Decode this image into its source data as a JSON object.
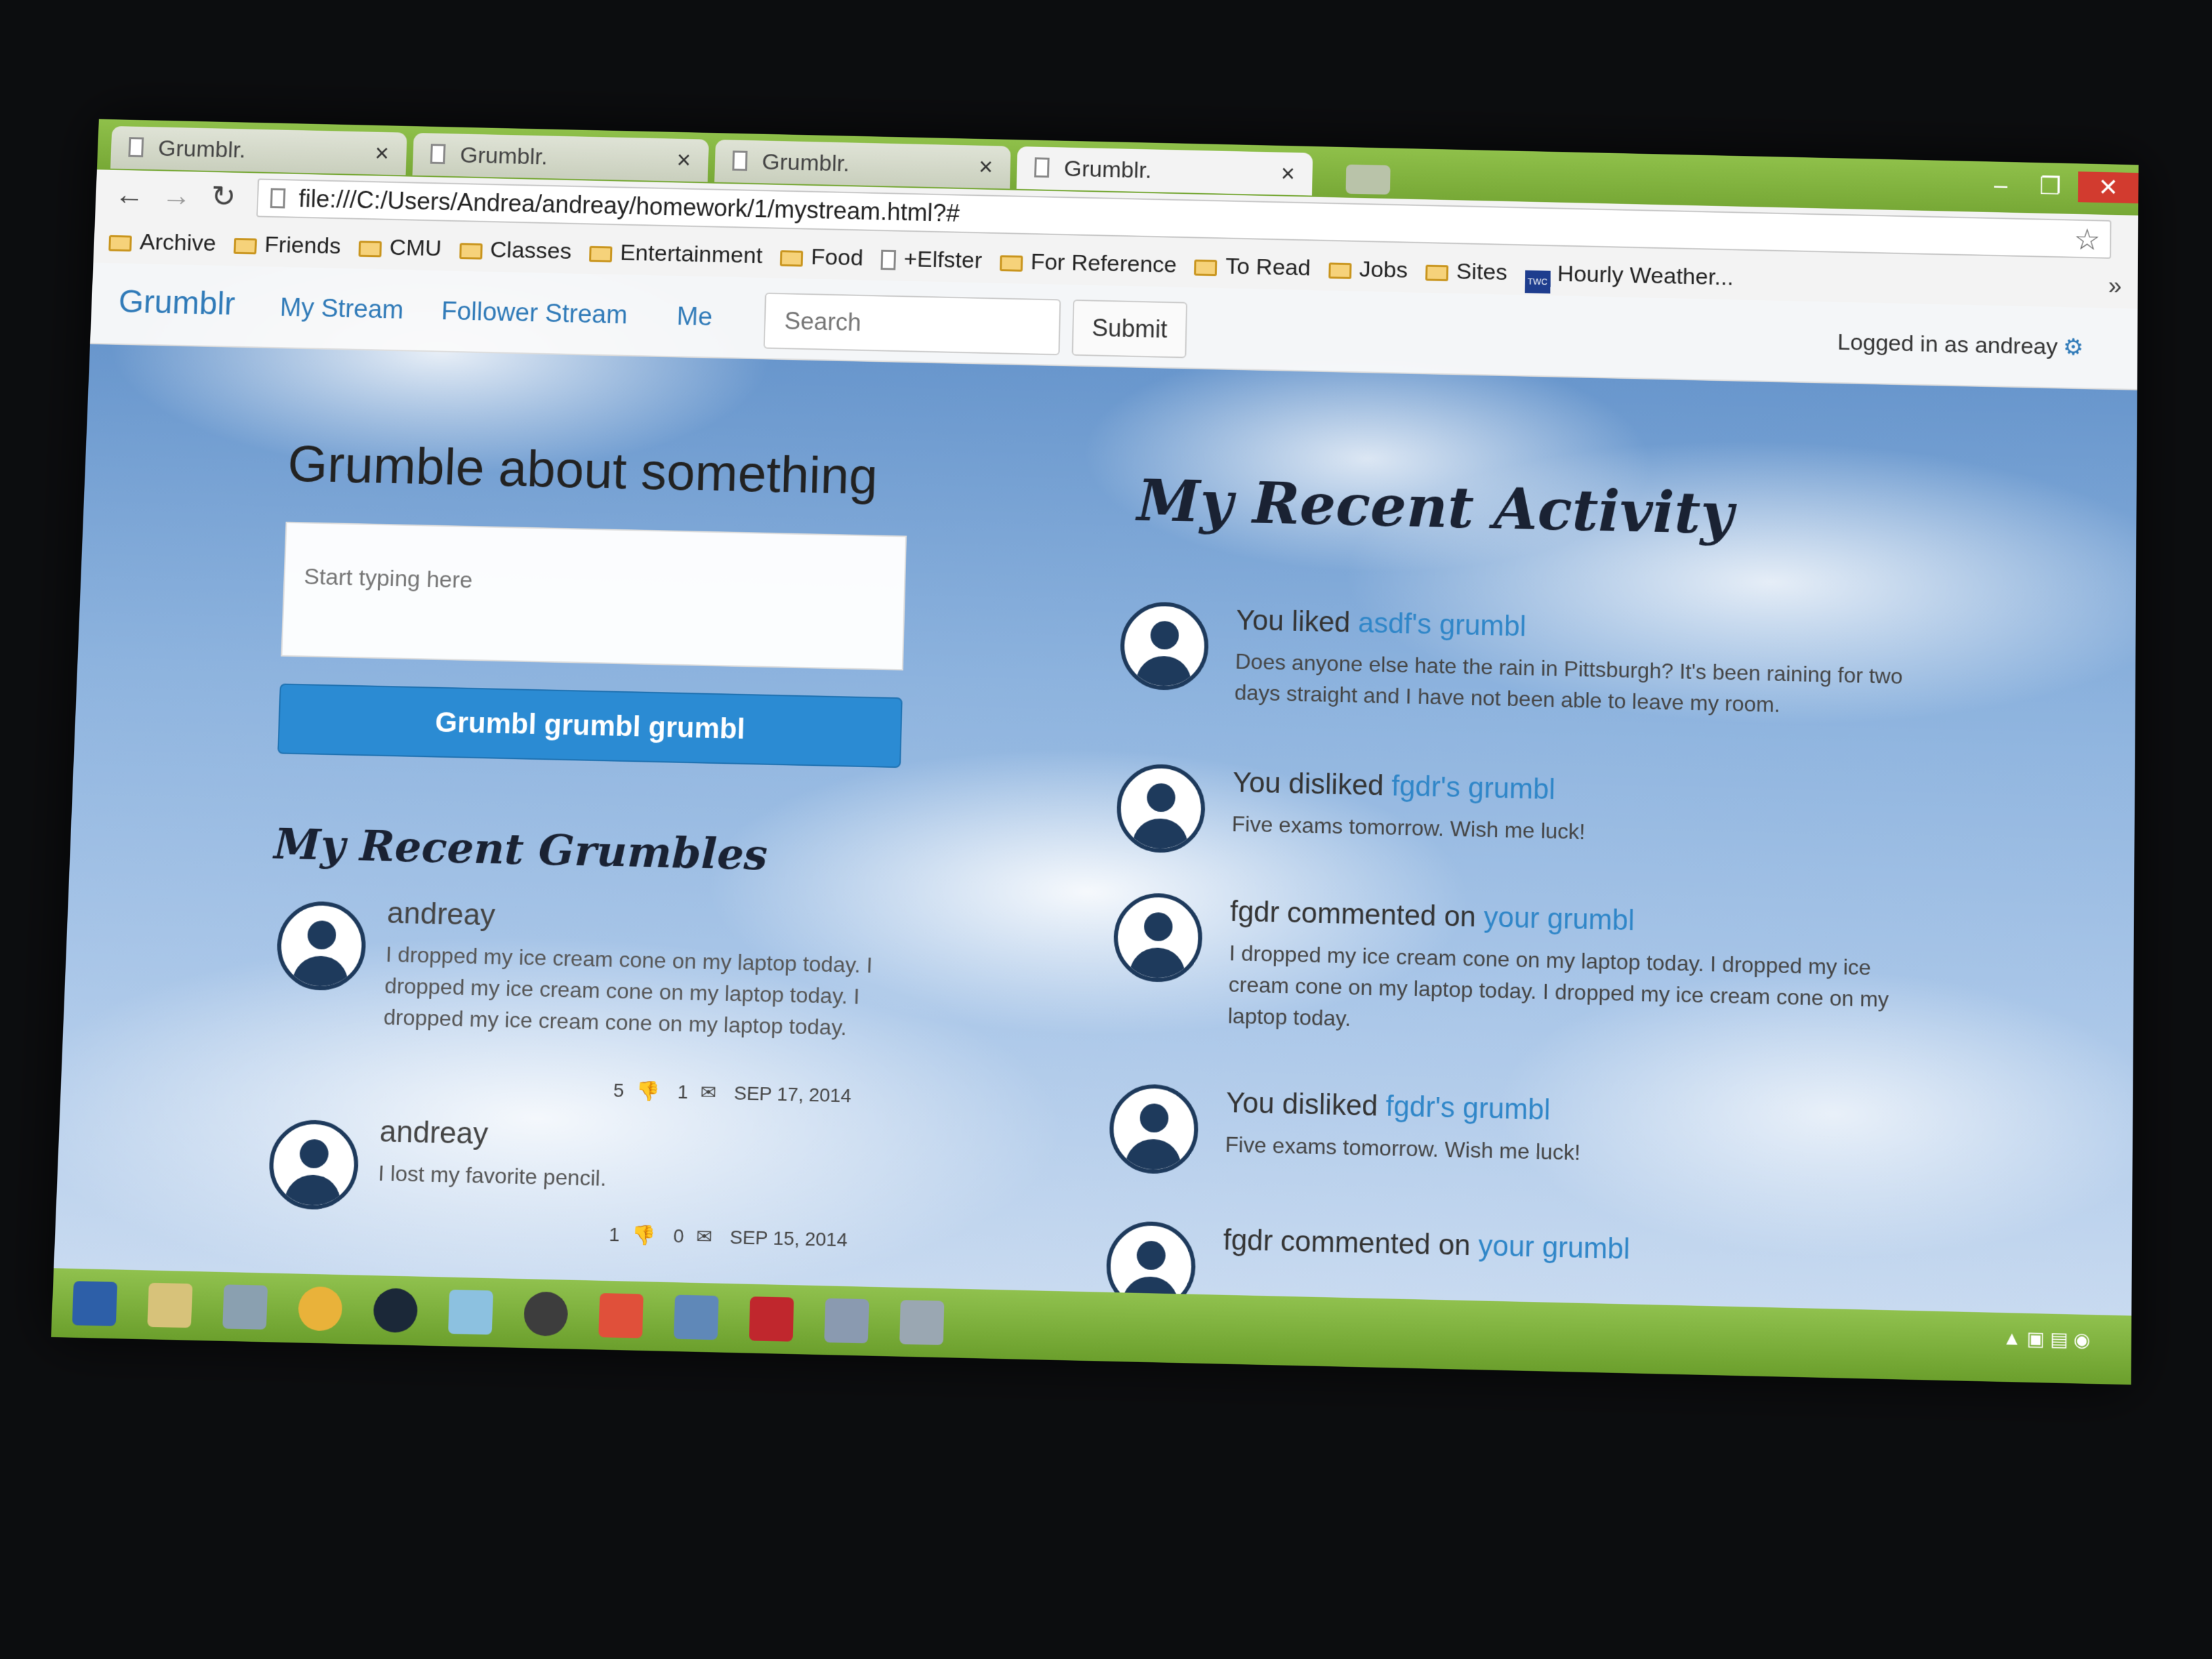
{
  "browser": {
    "tabs": [
      {
        "title": "Grumblr."
      },
      {
        "title": "Grumblr."
      },
      {
        "title": "Grumblr."
      },
      {
        "title": "Grumblr."
      }
    ],
    "url": "file:///C:/Users/Andrea/andreay/homework/1/mystream.html?#",
    "bookmarks": [
      "Archive",
      "Friends",
      "CMU",
      "Classes",
      "Entertainment",
      "Food",
      "+Elfster",
      "For Reference",
      "To Read",
      "Jobs",
      "Sites",
      "Hourly Weather..."
    ]
  },
  "navbar": {
    "brand": "Grumblr",
    "links": [
      "My Stream",
      "Follower Stream",
      "Me"
    ],
    "search_placeholder": "Search",
    "submit_label": "Submit",
    "logged_in": "Logged in as andreay"
  },
  "compose": {
    "title": "Grumble about something",
    "placeholder": "Start typing here",
    "button_label": "Grumbl grumbl grumbl"
  },
  "recent_grumbles": {
    "title": "My Recent Grumbles",
    "items": [
      {
        "user": "andreay",
        "text": "I dropped my ice cream cone on my laptop today. I dropped my ice cream cone on my laptop today. I dropped my ice cream cone on my laptop today.",
        "dislikes": "5",
        "comments": "1",
        "date": "SEP 17, 2014"
      },
      {
        "user": "andreay",
        "text": "I lost my favorite pencil.",
        "dislikes": "1",
        "comments": "0",
        "date": "SEP 15, 2014"
      }
    ]
  },
  "recent_activity": {
    "title": "My Recent Activity",
    "items": [
      {
        "action": "You liked ",
        "link": "asdf's grumbl",
        "text": "Does anyone else hate the rain in Pittsburgh? It's been raining for two days straight and I have not been able to leave my room."
      },
      {
        "action": "You disliked ",
        "link": "fgdr's grumbl",
        "text": "Five exams tomorrow. Wish me luck!"
      },
      {
        "action": "fgdr commented on ",
        "link": "your grumbl",
        "text": "I dropped my ice cream cone on my laptop today. I dropped my ice cream cone on my laptop today. I dropped my ice cream cone on my laptop today."
      },
      {
        "action": "You disliked ",
        "link": "fgdr's grumbl",
        "text": "Five exams tomorrow. Wish me luck!"
      },
      {
        "action": "fgdr commented on ",
        "link": "your grumbl",
        "text": ""
      }
    ]
  }
}
